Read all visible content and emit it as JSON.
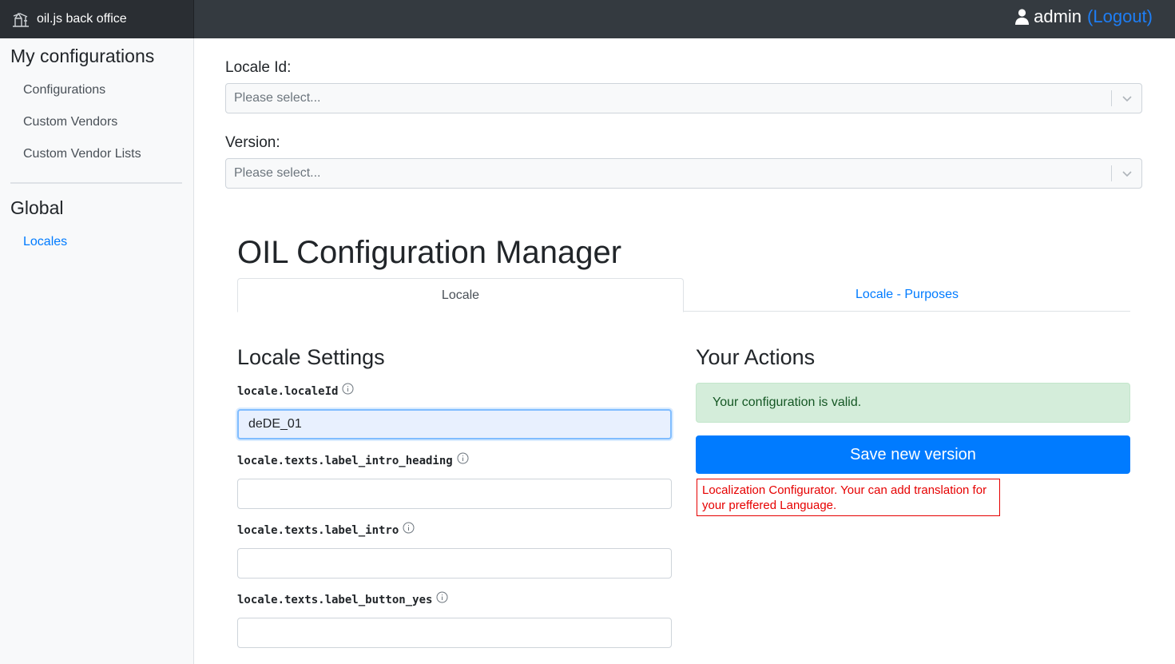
{
  "header": {
    "brand": "oil.js back office",
    "brand_icon": "oil-pump-icon",
    "user_icon": "user-icon",
    "username": "admin",
    "logout_label": "(Logout)"
  },
  "sidebar": {
    "section1_title": "My configurations",
    "section1_items": [
      {
        "label": "Configurations"
      },
      {
        "label": "Custom Vendors"
      },
      {
        "label": "Custom Vendor Lists"
      }
    ],
    "section2_title": "Global",
    "section2_items": [
      {
        "label": "Locales",
        "active": true
      }
    ]
  },
  "filters": {
    "locale_label": "Locale Id:",
    "locale_placeholder": "Please select...",
    "version_label": "Version:",
    "version_placeholder": "Please select..."
  },
  "page": {
    "title": "OIL Configuration Manager",
    "tabs": [
      {
        "label": "Locale",
        "active": true
      },
      {
        "label": "Locale - Purposes",
        "active": false
      }
    ]
  },
  "settings": {
    "title": "Locale Settings",
    "fields": [
      {
        "label": "locale.localeId",
        "value": "deDE_01"
      },
      {
        "label": "locale.texts.label_intro_heading",
        "value": ""
      },
      {
        "label": "locale.texts.label_intro",
        "value": ""
      },
      {
        "label": "locale.texts.label_button_yes",
        "value": ""
      }
    ]
  },
  "actions": {
    "title": "Your Actions",
    "valid_message": "Your configuration is valid.",
    "save_label": "Save new version",
    "tooltip": "Localization Configurator. Your can add translation for your preffered Language."
  },
  "colors": {
    "navbar": "#343a40",
    "accent": "#007bff",
    "success_bg": "#d4edda",
    "success_text": "#155724",
    "tooltip_red": "#e60000"
  }
}
